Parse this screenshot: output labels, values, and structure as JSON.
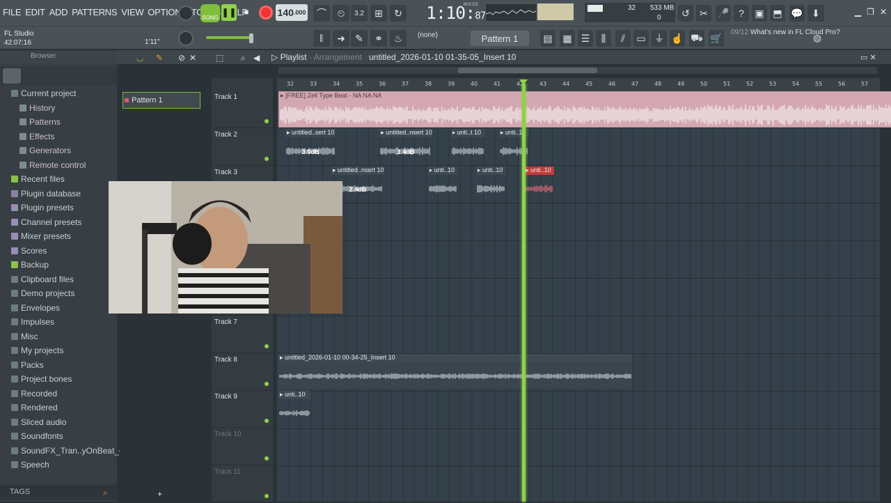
{
  "menu": [
    "FILE",
    "EDIT",
    "ADD",
    "PATTERNS",
    "VIEW",
    "OPTIONS",
    "TOOLS",
    "HELP"
  ],
  "transport": {
    "song_label": "SONG",
    "tempo": "140",
    "tempo_dec": ".000",
    "time": "1:10",
    "time_small": "87",
    "mcs": "M:S:CS"
  },
  "perf": {
    "cpu": "32",
    "mem": "533 MB",
    "poly": "0"
  },
  "app": {
    "name": "FL Studio",
    "clock": "42:07:16",
    "song_len": "1'11\""
  },
  "toolbar": {
    "none_label": "(none)",
    "pattern_label": "Pattern 1"
  },
  "news": {
    "date": "09/12",
    "text": "What's new in FL Cloud Pro?"
  },
  "browser": {
    "title": "Browser",
    "items": [
      {
        "label": "Current project",
        "kind": "fold"
      },
      {
        "label": "History",
        "kind": "sub"
      },
      {
        "label": "Patterns",
        "kind": "sub"
      },
      {
        "label": "Effects",
        "kind": "sub"
      },
      {
        "label": "Generators",
        "kind": "sub"
      },
      {
        "label": "Remote control",
        "kind": "sub"
      },
      {
        "label": "Recent files",
        "kind": "green"
      },
      {
        "label": "Plugin database",
        "kind": "db"
      },
      {
        "label": "Plugin presets",
        "kind": "p1"
      },
      {
        "label": "Channel presets",
        "kind": "p1"
      },
      {
        "label": "Mixer presets",
        "kind": "p1"
      },
      {
        "label": "Scores",
        "kind": "p1"
      },
      {
        "label": "Backup",
        "kind": "green"
      },
      {
        "label": "Clipboard files",
        "kind": "fold"
      },
      {
        "label": "Demo projects",
        "kind": "fold"
      },
      {
        "label": "Envelopes",
        "kind": "fold"
      },
      {
        "label": "Impulses",
        "kind": "fold"
      },
      {
        "label": "Misc",
        "kind": "fold"
      },
      {
        "label": "My projects",
        "kind": "fold"
      },
      {
        "label": "Packs",
        "kind": "fold"
      },
      {
        "label": "Project bones",
        "kind": "fold"
      },
      {
        "label": "Recorded",
        "kind": "fold"
      },
      {
        "label": "Rendered",
        "kind": "fold"
      },
      {
        "label": "Sliced audio",
        "kind": "fold"
      },
      {
        "label": "Soundfonts",
        "kind": "fold"
      },
      {
        "label": "SoundFX_Tran..yOnBeat_com",
        "kind": "fold"
      },
      {
        "label": "Speech",
        "kind": "fold"
      }
    ],
    "tags_label": "TAGS"
  },
  "playlist": {
    "label": "Playlist",
    "sub": "Arrangement",
    "project": "untitled_2026-01-10 01-35-05_Insert 10"
  },
  "patterns": [
    "Pattern 1"
  ],
  "tracks": [
    "Track 1",
    "Track 2",
    "Track 3",
    "",
    "",
    "",
    "Track 7",
    "Track 8",
    "Track 9",
    "Track 10",
    "Track 11"
  ],
  "ruler": [
    "32",
    "33",
    "34",
    "35",
    "36",
    "37",
    "38",
    "39",
    "40",
    "41",
    "42",
    "43",
    "44",
    "45",
    "46",
    "47",
    "48",
    "49",
    "50",
    "51",
    "52",
    "53",
    "54",
    "55",
    "56",
    "57"
  ],
  "clips": [
    {
      "track": 0,
      "start": 0,
      "len": 27,
      "label": "[FREE] Zell Type Beat - NA NA NA",
      "style": "audio1"
    },
    {
      "track": 1,
      "start": 0.3,
      "len": 2.2,
      "label": "untitled..sert 10",
      "gain": "3.0dB"
    },
    {
      "track": 1,
      "start": 4.4,
      "len": 2.3,
      "label": "untitled..nsert 10",
      "gain": "1.4dB"
    },
    {
      "track": 1,
      "start": 7.5,
      "len": 1.5,
      "label": "unti..t 10"
    },
    {
      "track": 1,
      "start": 9.6,
      "len": 1.3,
      "label": "unti..10"
    },
    {
      "track": 2,
      "start": 2.3,
      "len": 2.3,
      "label": "untitled..nsert 10",
      "gain": "2.4dB"
    },
    {
      "track": 2,
      "start": 6.5,
      "len": 1.3,
      "label": "unti..10"
    },
    {
      "track": 2,
      "start": 8.6,
      "len": 1.3,
      "label": "unti..10"
    },
    {
      "track": 2,
      "start": 10.7,
      "len": 1.3,
      "label": "unti..10",
      "style": "red"
    },
    {
      "track": 7,
      "start": 0,
      "len": 15.4,
      "label": "untitled_2026-01-10 00-34-25_Insert 10"
    },
    {
      "track": 8,
      "start": 0,
      "len": 1.4,
      "label": "unti..10"
    }
  ]
}
